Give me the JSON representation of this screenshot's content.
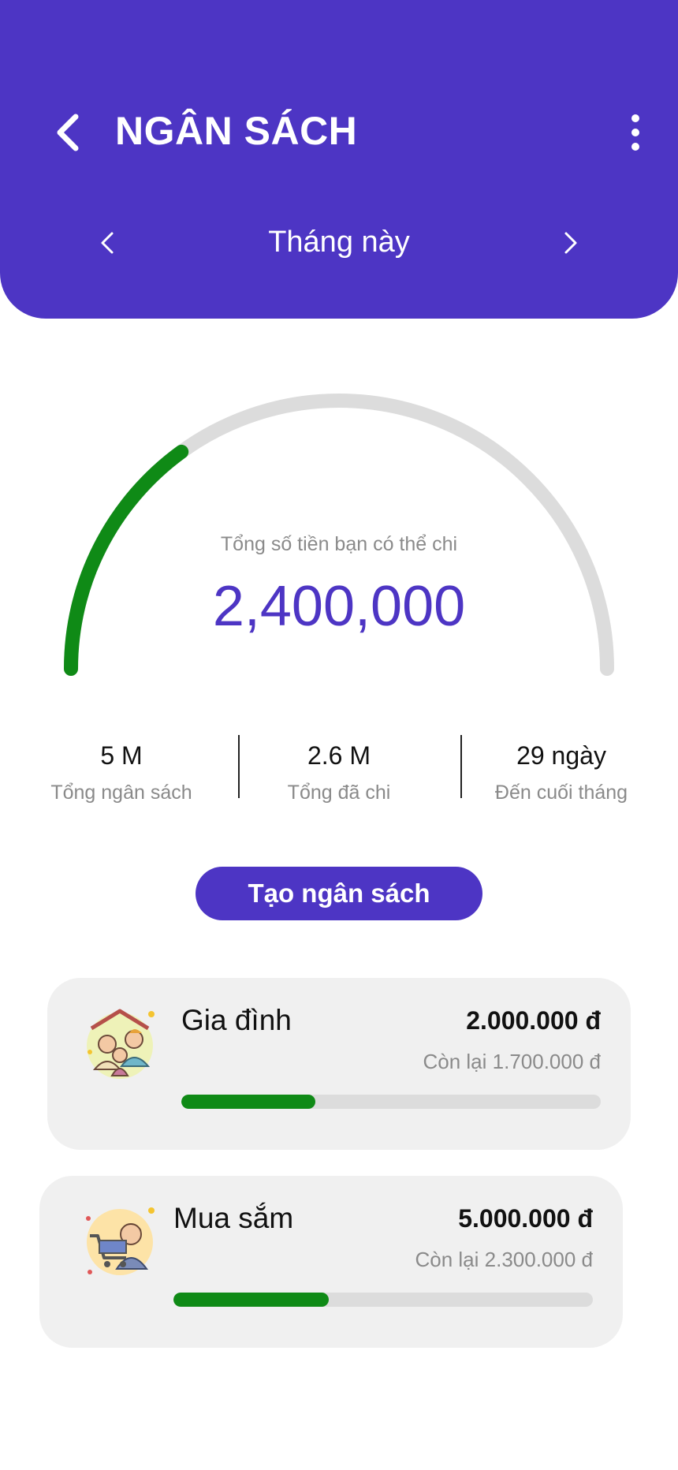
{
  "header": {
    "title": "NGÂN SÁCH",
    "period_label": "Tháng này",
    "background_color": "#4d35c4",
    "back_icon": "chevron-left-icon",
    "more_icon": "more-vertical-icon",
    "prev_icon": "chevron-left-icon",
    "next_icon": "chevron-right-icon"
  },
  "gauge": {
    "caption": "Tổng số tiền bạn có thể chi",
    "amount": "2,400,000",
    "spent_fraction": 0.3,
    "fill_color": "#0f8a16",
    "track_color": "#dcdcdc",
    "amount_color": "#4d35c4"
  },
  "stats": [
    {
      "value": "5 M",
      "label": "Tổng ngân sách"
    },
    {
      "value": "2.6 M",
      "label": "Tổng đã chi"
    },
    {
      "value": "29 ngày",
      "label": "Đến cuối tháng"
    }
  ],
  "create_button_label": "Tạo ngân sách",
  "budgets": [
    {
      "name": "Gia đình",
      "amount": "2.000.000 đ",
      "remaining": "Còn lại  1.700.000 đ",
      "progress": 0.32,
      "icon": "family-icon",
      "bar_color": "#0f8a16"
    },
    {
      "name": "Mua sắm",
      "amount": "5.000.000 đ",
      "remaining": "Còn lại  2.300.000 đ",
      "progress": 0.37,
      "icon": "shopping-cart-icon",
      "bar_color": "#0f8a16"
    }
  ]
}
